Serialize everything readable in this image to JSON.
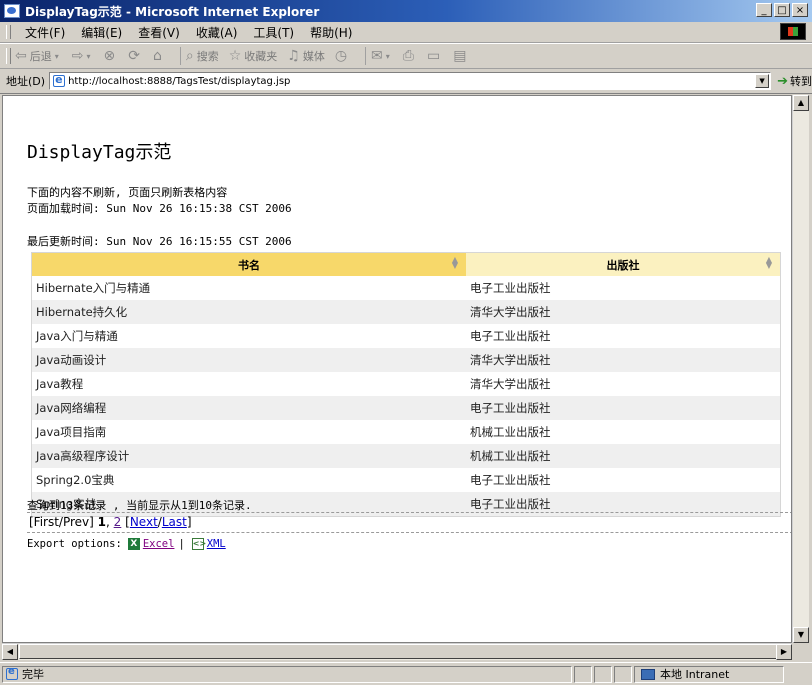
{
  "window": {
    "title": "DisplayTag示范 - Microsoft Internet Explorer",
    "buttons": [
      "_",
      "□",
      "×"
    ]
  },
  "menu": {
    "items": [
      "文件(F)",
      "编辑(E)",
      "查看(V)",
      "收藏(A)",
      "工具(T)",
      "帮助(H)"
    ]
  },
  "toolbar": {
    "back_label": "后退",
    "search_label": "搜索",
    "favorites_label": "收藏夹",
    "media_label": "媒体"
  },
  "address": {
    "label": "地址(D)",
    "url": "http://localhost:8888/TagsTest/displaytag.jsp",
    "go_label": "转到"
  },
  "page": {
    "title": "DisplayTag示范",
    "note": "下面的内容不刷新, 页面只刷新表格内容",
    "load_time": "页面加载时间: Sun Nov 26 16:15:38 CST 2006",
    "update_time": "最后更新时间: Sun Nov 26 16:15:55 CST 2006"
  },
  "table": {
    "headers": [
      "书名",
      "出版社"
    ],
    "rows": [
      [
        "Hibernate入门与精通",
        "电子工业出版社"
      ],
      [
        "Hibernate持久化",
        "清华大学出版社"
      ],
      [
        "Java入门与精通",
        "电子工业出版社"
      ],
      [
        "Java动画设计",
        "清华大学出版社"
      ],
      [
        "Java教程",
        "清华大学出版社"
      ],
      [
        "Java网络编程",
        "电子工业出版社"
      ],
      [
        "Java项目指南",
        "机械工业出版社"
      ],
      [
        "Java高级程序设计",
        "机械工业出版社"
      ],
      [
        "Spring2.0宝典",
        "电子工业出版社"
      ],
      [
        "Spring实战",
        "电子工业出版社"
      ]
    ]
  },
  "summary": "查询到13条记录 , 当前显示从1到10条记录.",
  "pager": {
    "open": "[First/Prev] ",
    "page1": "1",
    "comma": ", ",
    "page2": "2",
    "sp": " ",
    "lb": "[",
    "next": "Next",
    "slash": "/",
    "last": "Last",
    "rb": "]"
  },
  "exports": {
    "label": "Export options:",
    "excel": "Excel",
    "divider": "|",
    "xml": "XML"
  },
  "status": {
    "text": "完毕",
    "zone": "本地 Intranet"
  },
  "colors": {
    "header_primary": "#f7d86a",
    "header_secondary": "#fbf1c0",
    "row_alt": "#efefef",
    "link": "#0000cc",
    "titlebar": "#0a246a"
  }
}
